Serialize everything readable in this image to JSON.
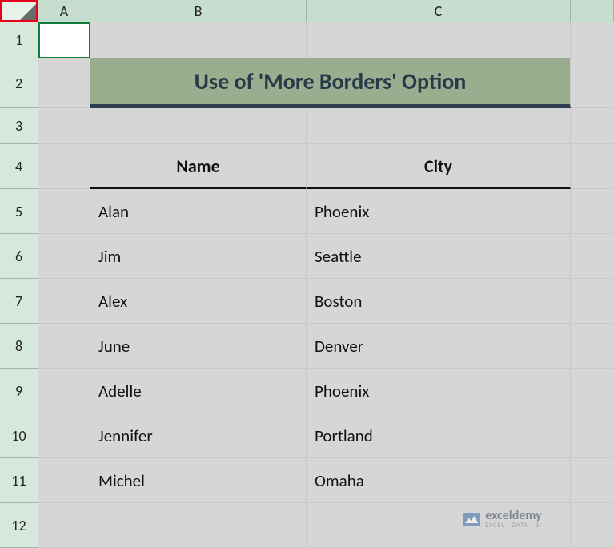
{
  "columns": {
    "A": "A",
    "B": "B",
    "C": "C",
    "D": ""
  },
  "rows": {
    "1": "1",
    "2": "2",
    "3": "3",
    "4": "4",
    "5": "5",
    "6": "6",
    "7": "7",
    "8": "8",
    "9": "9",
    "10": "10",
    "11": "11",
    "12": "12"
  },
  "title": "Use of 'More Borders' Option",
  "headers": {
    "name": "Name",
    "city": "City"
  },
  "data": [
    {
      "name": "Alan",
      "city": "Phoenix"
    },
    {
      "name": "Jim",
      "city": "Seattle"
    },
    {
      "name": "Alex",
      "city": "Boston"
    },
    {
      "name": "June",
      "city": "Denver"
    },
    {
      "name": "Adelle",
      "city": "Phoenix"
    },
    {
      "name": "Jennifer",
      "city": "Portland"
    },
    {
      "name": "Michel",
      "city": "Omaha"
    }
  ],
  "watermark": {
    "main": "exceldemy",
    "sub": "EXCEL · DATA · BI"
  },
  "chart_data": {
    "type": "table",
    "title": "Use of 'More Borders' Option",
    "columns": [
      "Name",
      "City"
    ],
    "rows": [
      [
        "Alan",
        "Phoenix"
      ],
      [
        "Jim",
        "Seattle"
      ],
      [
        "Alex",
        "Boston"
      ],
      [
        "June",
        "Denver"
      ],
      [
        "Adelle",
        "Phoenix"
      ],
      [
        "Jennifer",
        "Portland"
      ],
      [
        "Michel",
        "Omaha"
      ]
    ]
  }
}
